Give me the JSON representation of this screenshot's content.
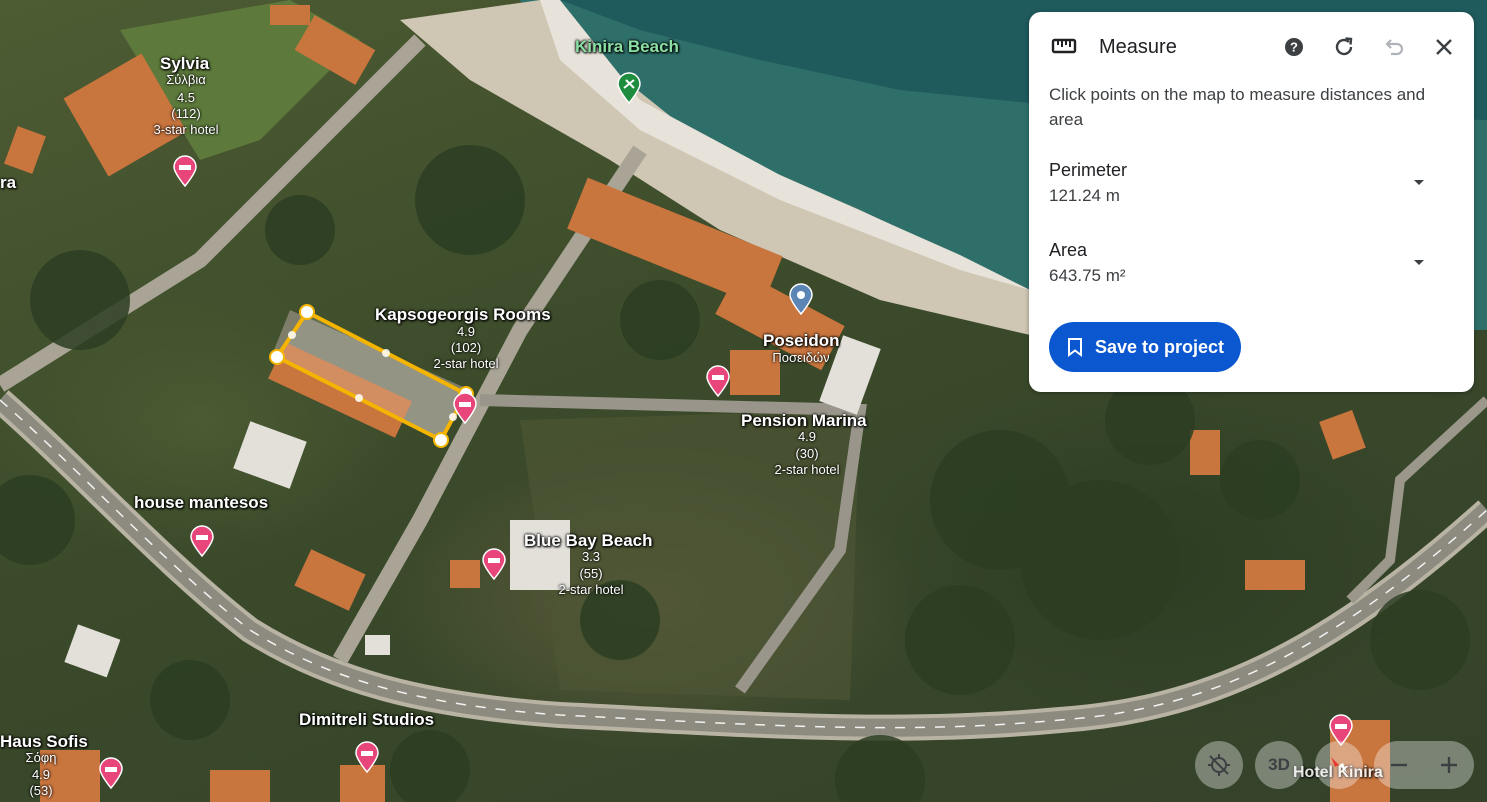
{
  "panel": {
    "title": "Measure",
    "instructions": "Click points on the map to measure distances and area",
    "perimeter": {
      "label": "Perimeter",
      "value": "121.24 m"
    },
    "area": {
      "label": "Area",
      "value": "643.75 m²"
    },
    "save_button": "Save to project",
    "icons": [
      "ruler-icon",
      "help-icon",
      "reset-icon",
      "undo-icon",
      "close-icon"
    ]
  },
  "map": {
    "places": [
      {
        "name": "Kinira Beach"
      },
      {
        "name": "Sylvia",
        "alt": "Σύλβια",
        "rating": "4.5",
        "reviews": "(112)",
        "type": "3-star hotel"
      },
      {
        "name": "Kapsogeorgis Rooms",
        "rating": "4.9",
        "reviews": "(102)",
        "type": "2-star hotel"
      },
      {
        "name": "Poseidon",
        "alt": "Ποσειδών"
      },
      {
        "name": "Pension Marina",
        "rating": "4.9",
        "reviews": "(30)",
        "type": "2-star hotel"
      },
      {
        "name": "house mantesos"
      },
      {
        "name": "Blue Bay Beach",
        "rating": "3.3",
        "reviews": "(55)",
        "type": "2-star hotel"
      },
      {
        "name": "Dimitreli Studios"
      },
      {
        "name": "Haus Sofis",
        "alt": "Σόφη",
        "rating": "4.9",
        "reviews": "(53)"
      },
      {
        "name": "Hotel Kinira"
      },
      {
        "name": "ra"
      }
    ]
  },
  "controls": {
    "three_d": "3D"
  },
  "colors": {
    "accent": "#0b57d0",
    "measure_line": "#f4b400",
    "hotel_pin": "#e8457a"
  }
}
